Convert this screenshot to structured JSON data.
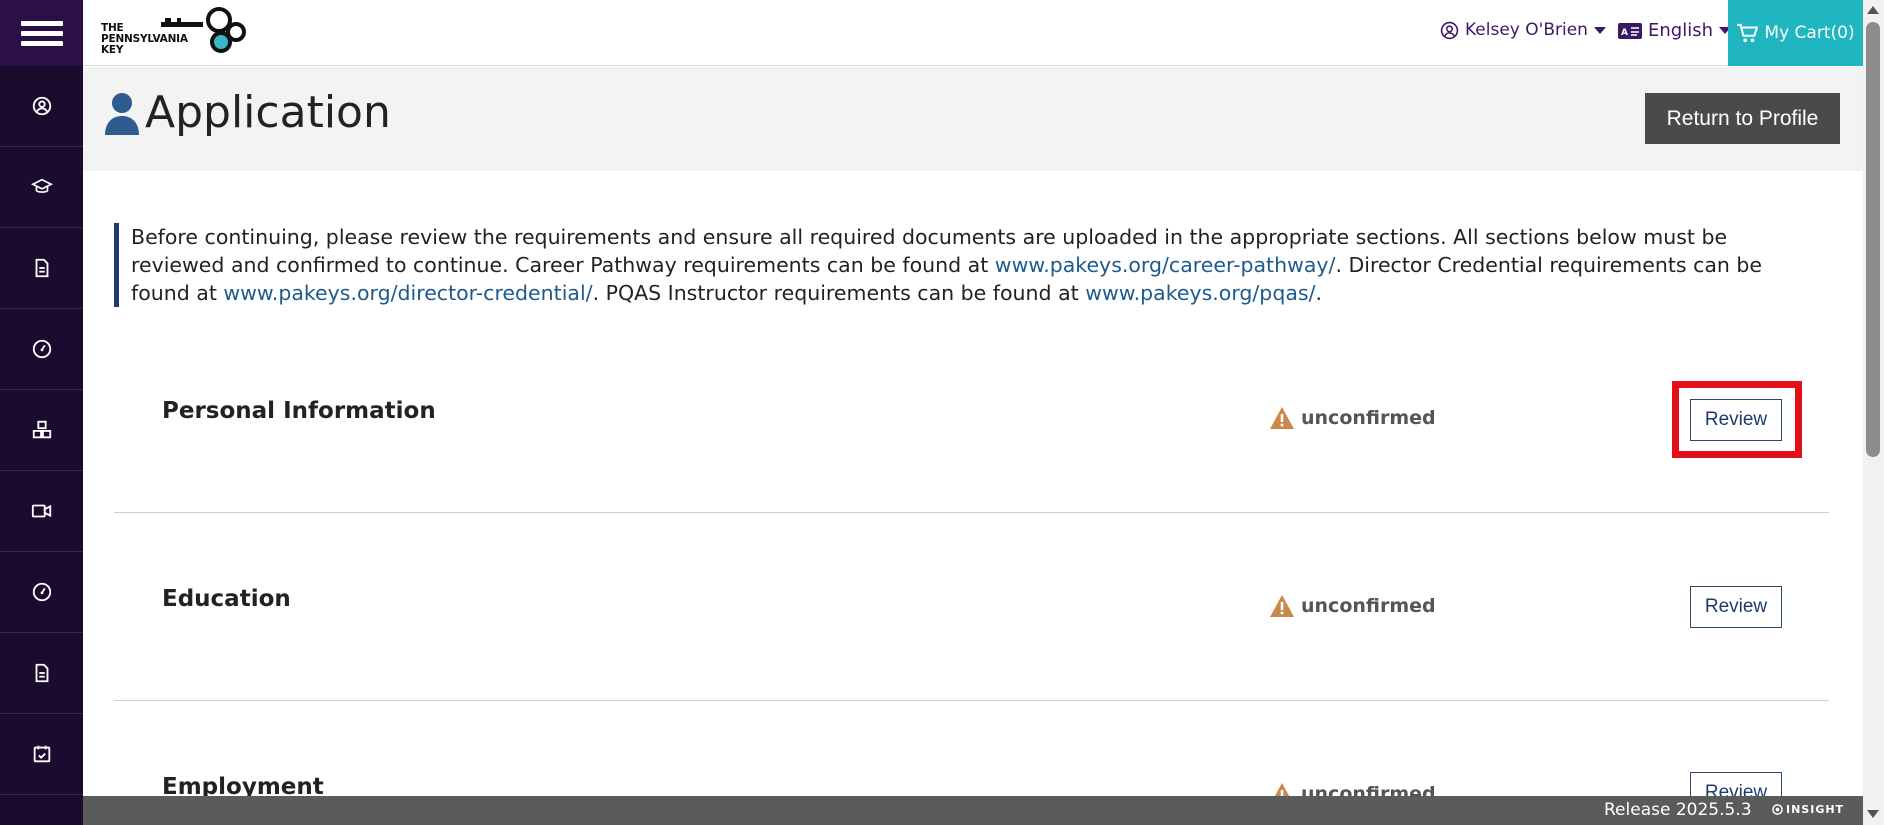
{
  "header": {
    "logo_line1": "THE",
    "logo_line2": "PENNSYLVANIA",
    "logo_line3": "KEY",
    "user_name": "Kelsey O'Brien",
    "language": "English",
    "cart_label": "My Cart(0)"
  },
  "sidebar": {
    "items": [
      {
        "icon": "profile-icon"
      },
      {
        "icon": "graduation-cap-icon"
      },
      {
        "icon": "document-icon"
      },
      {
        "icon": "dashboard-icon"
      },
      {
        "icon": "blocks-icon"
      },
      {
        "icon": "video-icon"
      },
      {
        "icon": "dashboard-icon"
      },
      {
        "icon": "document-icon"
      },
      {
        "icon": "calendar-check-icon"
      }
    ]
  },
  "page": {
    "title": "Application",
    "return_button": "Return to Profile"
  },
  "notice": {
    "part1": "Before continuing, please review the requirements and ensure all required documents are uploaded in the appropriate sections. All sections below must be reviewed and confirmed to continue. Career Pathway requirements can be found at ",
    "link1": "www.pakeys.org/career-pathway/",
    "part2": ". Director Credential requirements can be found at ",
    "link2": "www.pakeys.org/director-credential/",
    "part3": ". PQAS Instructor requirements can be found at ",
    "link3": "www.pakeys.org/pqas/",
    "part4": "."
  },
  "sections": [
    {
      "title": "Personal Information",
      "status": "unconfirmed",
      "button": "Review"
    },
    {
      "title": "Education",
      "status": "unconfirmed",
      "button": "Review"
    },
    {
      "title": "Employment",
      "status": "unconfirmed",
      "button": "Review"
    }
  ],
  "footer": {
    "release": "Release 2025.5.3",
    "brand": "INSIGHT"
  },
  "colors": {
    "sidebar_bg": "#1b0b2e",
    "accent_purple": "#3b1a63",
    "cart_teal": "#1fb6c1",
    "link_blue": "#1f5a8c",
    "warning": "#c8894a",
    "highlight_red": "#e3101a"
  }
}
